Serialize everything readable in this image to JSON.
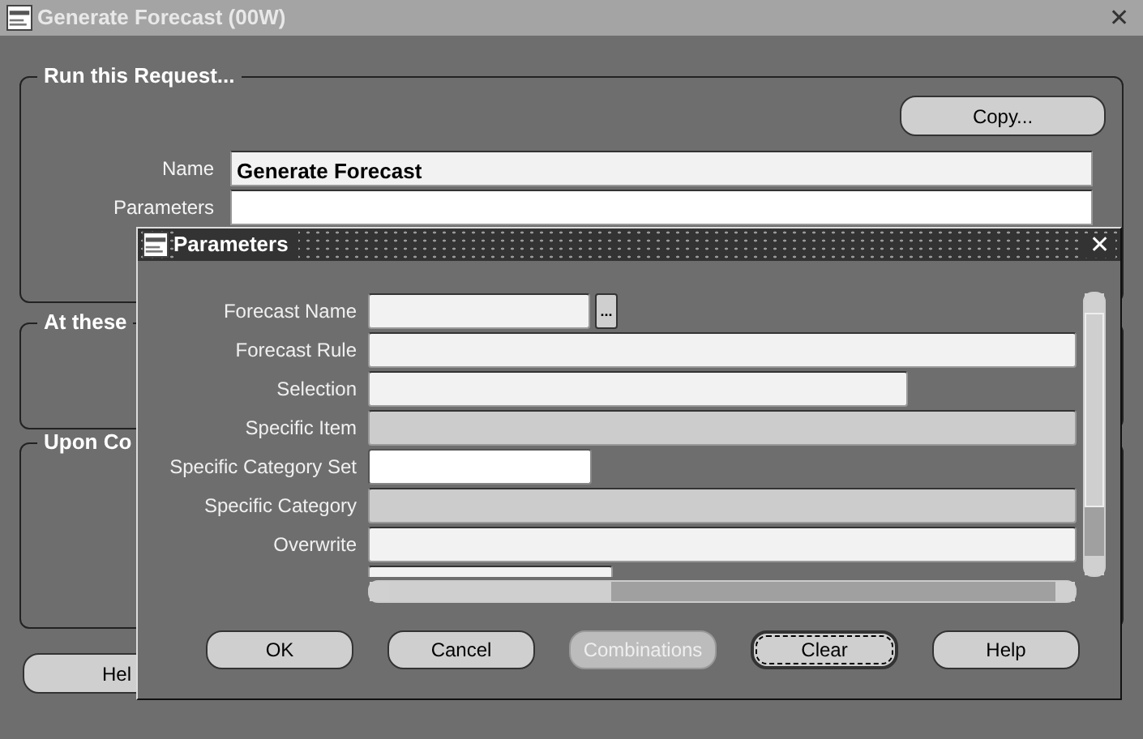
{
  "window": {
    "title": "Generate Forecast (00W)",
    "close_icon": "✕"
  },
  "run_request": {
    "title": "Run this Request...",
    "copy_button": "Copy...",
    "name_label": "Name",
    "name_value": "Generate Forecast",
    "parameters_label": "Parameters"
  },
  "groups": [
    {
      "title": "At these"
    },
    {
      "title": "Upon Co"
    }
  ],
  "help_button": {
    "label": "Hel"
  },
  "dialog": {
    "title": "Parameters",
    "close_icon": "✕",
    "fields": [
      {
        "label": "Forecast Name",
        "disabled": false,
        "focused": false,
        "lov_button": "..."
      },
      {
        "label": "Forecast Rule",
        "disabled": false,
        "focused": false
      },
      {
        "label": "Selection",
        "disabled": false,
        "focused": false
      },
      {
        "label": "Specific Item",
        "disabled": true,
        "focused": false
      },
      {
        "label": "Specific Category Set",
        "disabled": false,
        "focused": true
      },
      {
        "label": "Specific Category",
        "disabled": true,
        "focused": false
      },
      {
        "label": "Overwrite",
        "disabled": false,
        "focused": false
      },
      {
        "disabled": false,
        "focused": false
      }
    ],
    "buttons": [
      {
        "label": "OK",
        "disabled": false,
        "focused": false
      },
      {
        "label": "Cancel",
        "disabled": false,
        "focused": false
      },
      {
        "label": "Combinations",
        "disabled": true,
        "focused": false
      },
      {
        "label": "Clear",
        "disabled": false,
        "focused": true
      },
      {
        "label": "Help",
        "disabled": false,
        "focused": false
      }
    ]
  }
}
